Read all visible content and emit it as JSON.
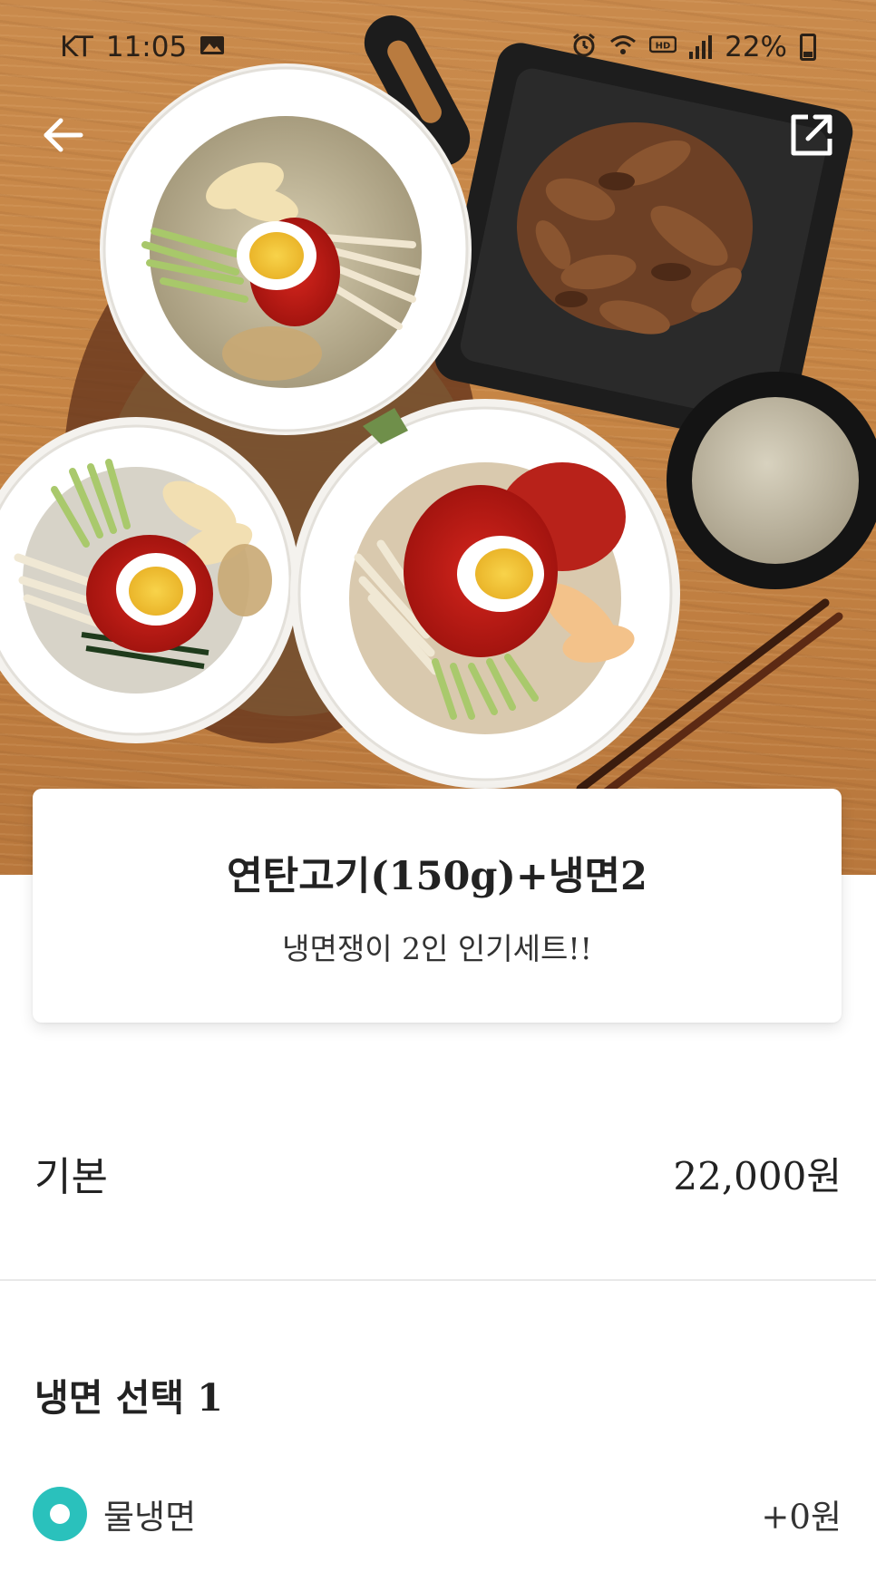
{
  "status_bar": {
    "carrier": "KT",
    "time": "11:05",
    "battery": "22%",
    "icons": [
      "image-icon",
      "alarm-icon",
      "wifi-icon",
      "hd-icon",
      "signal-icon",
      "battery-icon"
    ]
  },
  "nav": {
    "back_icon": "arrow-left-icon",
    "share_icon": "share-icon"
  },
  "hero": {
    "image_subject": "food-photo"
  },
  "menu": {
    "title": "연탄고기(150g)+냉면2",
    "subtitle": "냉면쟁이 2인 인기세트!!"
  },
  "price": {
    "label": "기본",
    "value": "22,000원"
  },
  "option_group": {
    "title": "냉면 선택 1",
    "options": [
      {
        "label": "물냉면",
        "price": "+0원",
        "selected": true
      }
    ]
  },
  "colors": {
    "accent": "#2ac1bc",
    "text": "#222222",
    "divider": "#e8e8e8"
  }
}
